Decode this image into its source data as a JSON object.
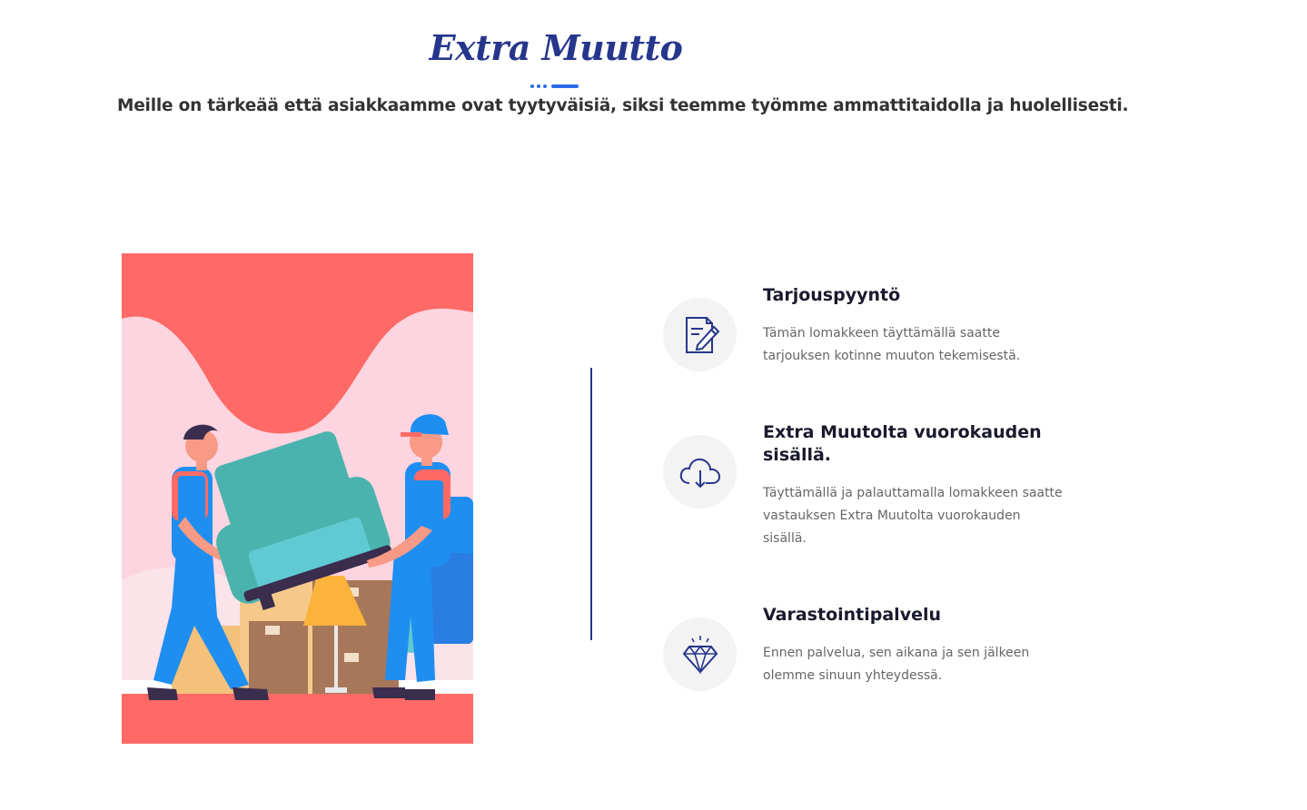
{
  "header": {
    "title": "Extra Muutto",
    "subtitle": "Meille on tärkeää että asiakkaamme ovat tyytyväisiä, siksi teemme työmme ammattitaidolla ja huolellisesti."
  },
  "illustration": {
    "icon": "movers-carrying-armchair-illustration"
  },
  "features": [
    {
      "icon": "form-pencil-icon",
      "title": "Tarjouspyyntö",
      "description": "Tämän lomakkeen täyttämällä saatte tarjouksen kotinne muuton tekemisestä."
    },
    {
      "icon": "cloud-download-icon",
      "title": "Extra Muutolta vuorokauden sisällä.",
      "description": "Täyttämällä ja palauttamalla lomakkeen saatte vastauksen Extra Muutolta vuorokauden sisällä."
    },
    {
      "icon": "diamond-icon",
      "title": "Varastointipalvelu",
      "description": "Ennen palvelua, sen aikana ja sen jälkeen olemme sinuun yhteydessä."
    }
  ],
  "colors": {
    "brand": "#26368c",
    "accent": "#2b6be8",
    "coral": "#ff6a66",
    "pink": "#fdd5e0"
  }
}
